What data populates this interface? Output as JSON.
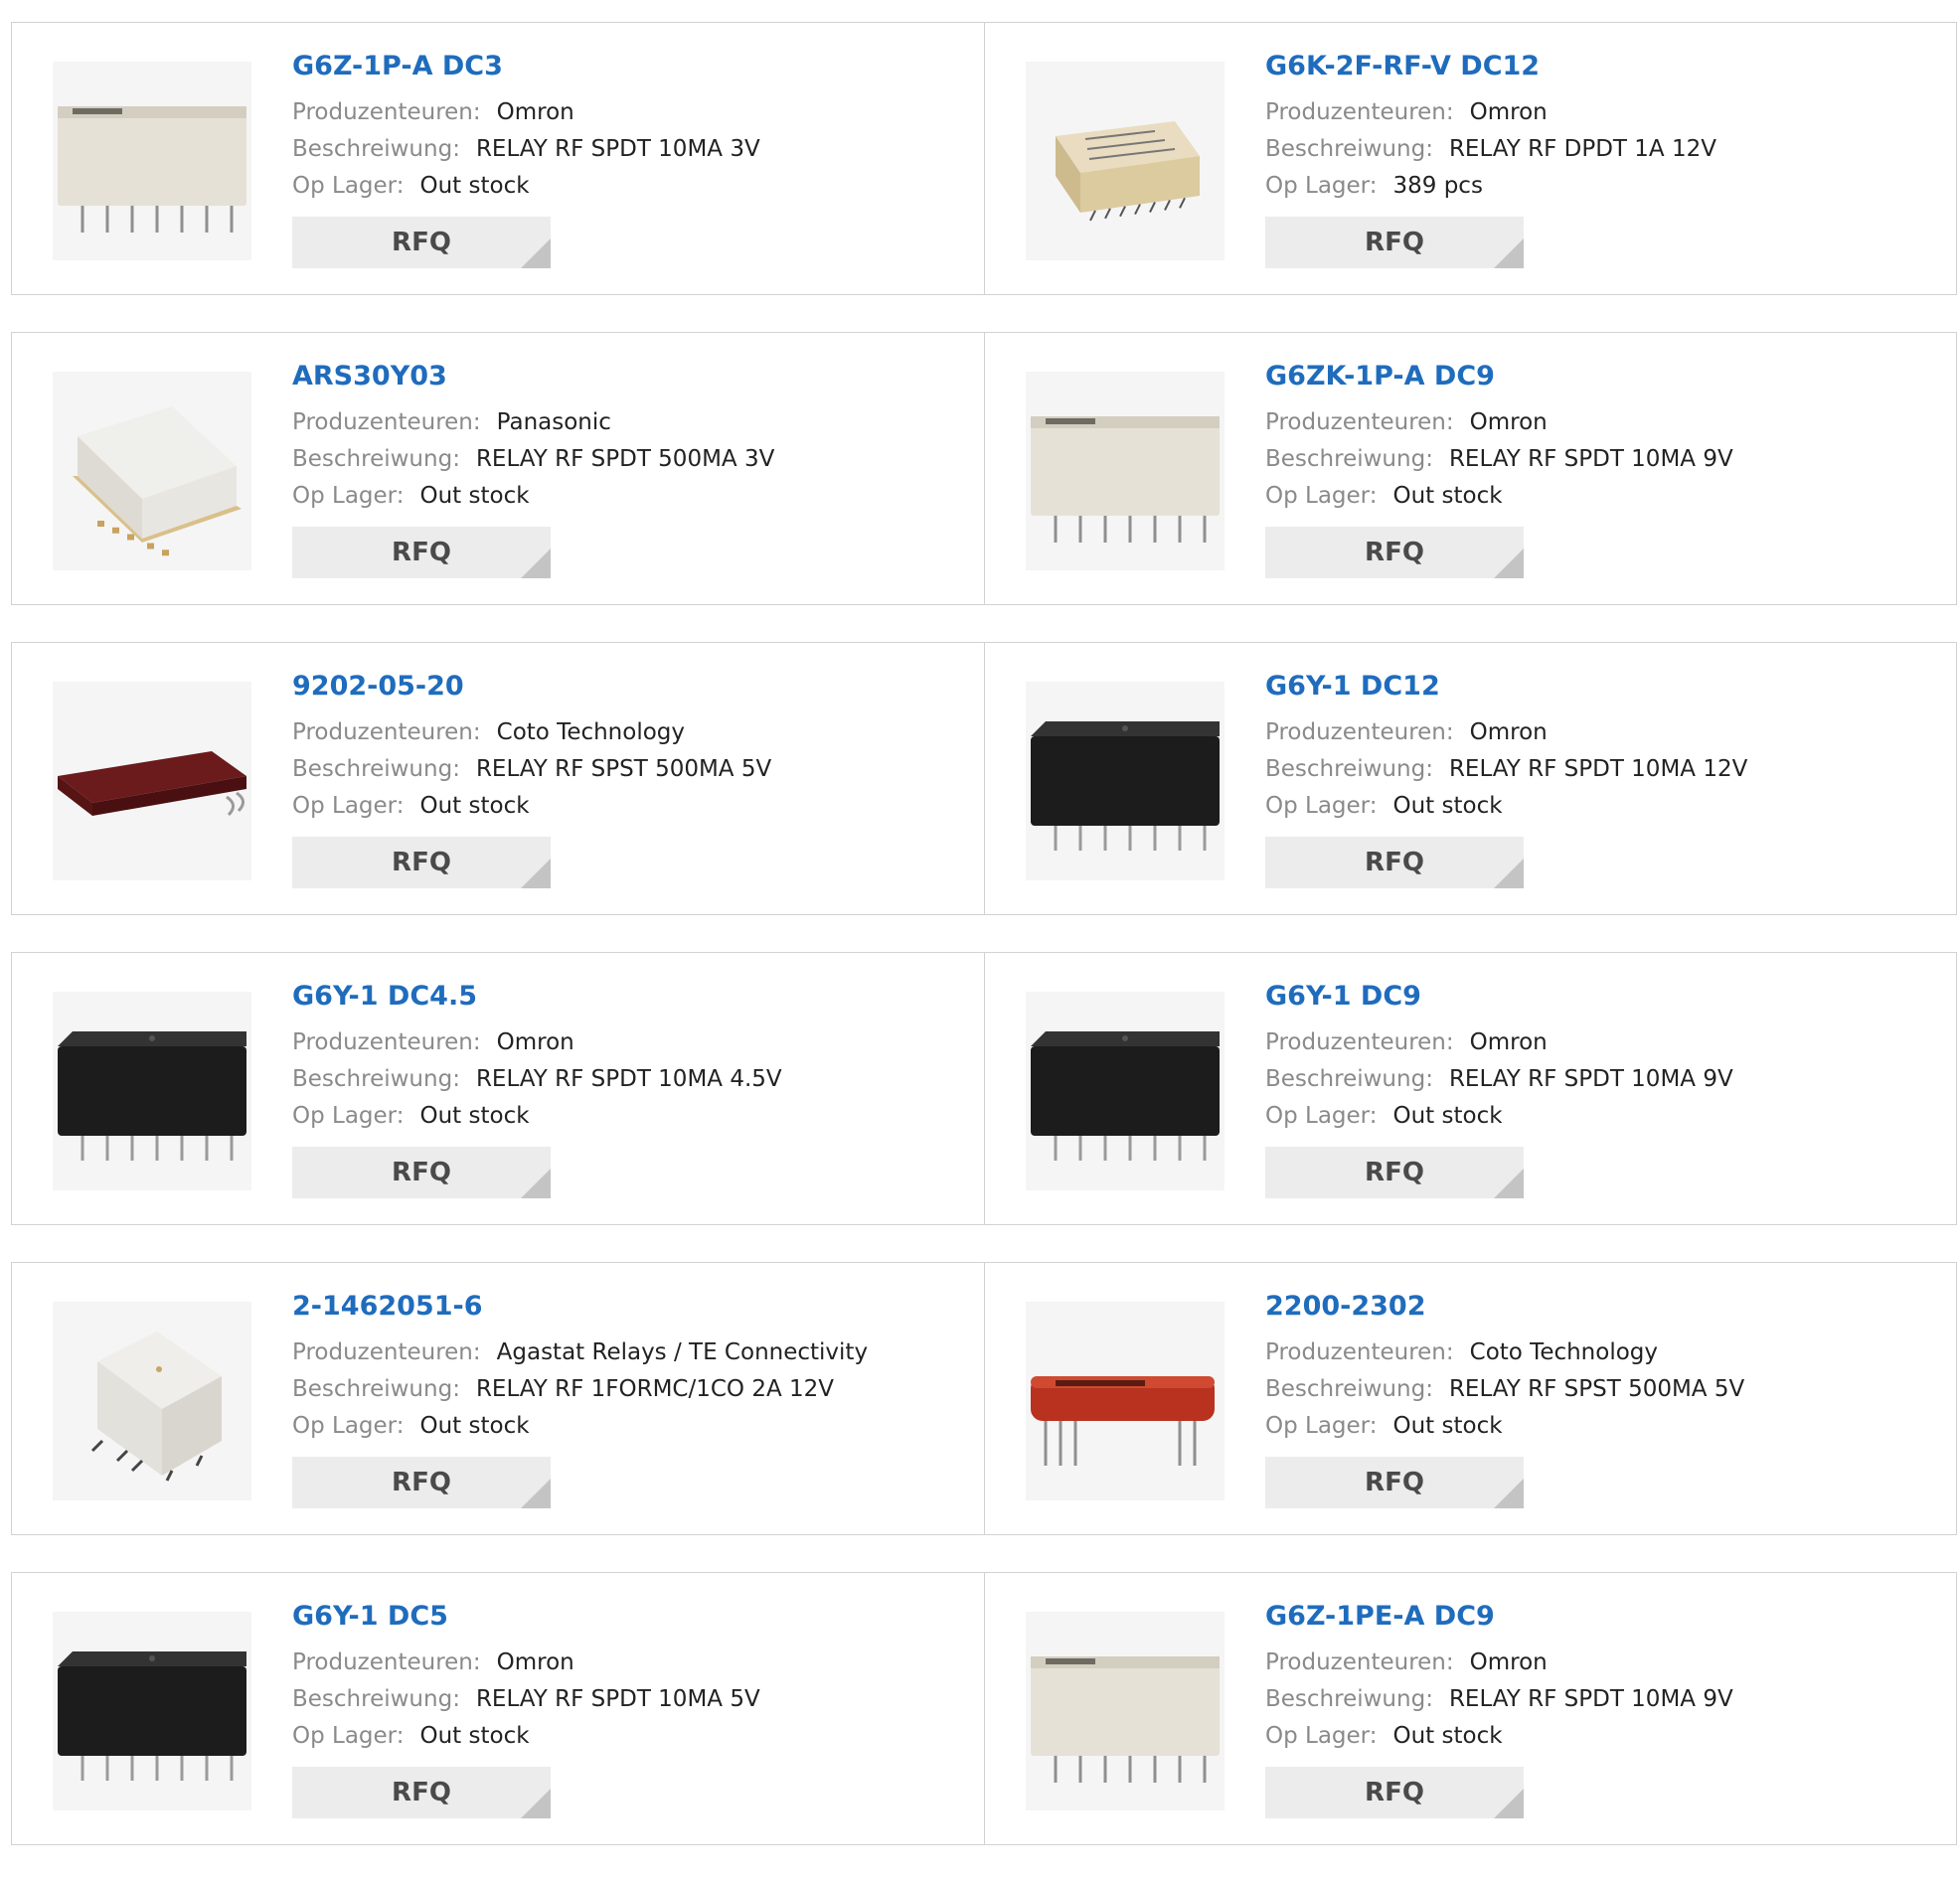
{
  "labels": {
    "manufacturer": "Produzenteuren:",
    "description": "Beschreiwung:",
    "stock": "Op Lager:",
    "rfq": "RFQ"
  },
  "colors": {
    "link": "#1f6cbd",
    "label": "#8a8a8a",
    "value": "#222222",
    "button_bg": "#ececec",
    "button_text": "#4a4a4a",
    "border": "#d2d2d2"
  },
  "products": [
    {
      "part": "G6Z-1P-A DC3",
      "manufacturer": "Omron",
      "description": "RELAY RF SPDT 10MA 3V",
      "stock": "Out stock",
      "image": "relay-beige-through-hole"
    },
    {
      "part": "G6K-2F-RF-V DC12",
      "manufacturer": "Omron",
      "description": "RELAY RF DPDT 1A 12V",
      "stock": "389 pcs",
      "image": "relay-beige-smd-small"
    },
    {
      "part": "ARS30Y03",
      "manufacturer": "Panasonic",
      "description": "RELAY RF SPDT 500MA 3V",
      "stock": "Out stock",
      "image": "relay-white-smd"
    },
    {
      "part": "G6ZK-1P-A DC9",
      "manufacturer": "Omron",
      "description": "RELAY RF SPDT 10MA 9V",
      "stock": "Out stock",
      "image": "relay-beige-through-hole"
    },
    {
      "part": "9202-05-20",
      "manufacturer": "Coto Technology",
      "description": "RELAY RF SPST 500MA 5V",
      "stock": "Out stock",
      "image": "relay-darkred-reed"
    },
    {
      "part": "G6Y-1 DC12",
      "manufacturer": "Omron",
      "description": "RELAY RF SPDT 10MA 12V",
      "stock": "Out stock",
      "image": "relay-black-through-hole"
    },
    {
      "part": "G6Y-1 DC4.5",
      "manufacturer": "Omron",
      "description": "RELAY RF SPDT 10MA 4.5V",
      "stock": "Out stock",
      "image": "relay-black-through-hole"
    },
    {
      "part": "G6Y-1 DC9",
      "manufacturer": "Omron",
      "description": "RELAY RF SPDT 10MA 9V",
      "stock": "Out stock",
      "image": "relay-black-through-hole"
    },
    {
      "part": "2-1462051-6",
      "manufacturer": "Agastat Relays / TE Connectivity",
      "description": "RELAY RF 1FORMC/1CO 2A 12V",
      "stock": "Out stock",
      "image": "relay-white-cube-smd"
    },
    {
      "part": "2200-2302",
      "manufacturer": "Coto Technology",
      "description": "RELAY RF SPST 500MA 5V",
      "stock": "Out stock",
      "image": "relay-red-reed"
    },
    {
      "part": "G6Y-1 DC5",
      "manufacturer": "Omron",
      "description": "RELAY RF SPDT 10MA 5V",
      "stock": "Out stock",
      "image": "relay-black-through-hole"
    },
    {
      "part": "G6Z-1PE-A DC9",
      "manufacturer": "Omron",
      "description": "RELAY RF SPDT 10MA 9V",
      "stock": "Out stock",
      "image": "relay-beige-through-hole"
    }
  ]
}
